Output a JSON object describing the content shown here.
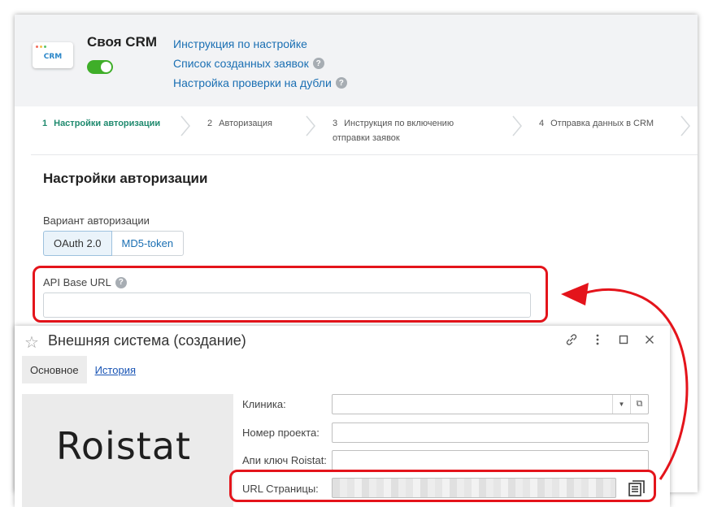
{
  "crm": {
    "logo_text": "CRM",
    "name": "Своя CRM",
    "links": [
      {
        "label": "Инструкция по настройке",
        "help": false
      },
      {
        "label": "Список созданных заявок",
        "help": true
      },
      {
        "label": "Настройка проверки на дубли",
        "help": true
      }
    ],
    "toggle_on": true
  },
  "steps": [
    {
      "num": "1",
      "label": "Настройки авторизации",
      "active": true
    },
    {
      "num": "2",
      "label": "Авторизация",
      "active": false
    },
    {
      "num": "3",
      "label": "Инструкция по включению",
      "label2": "отправки заявок",
      "active": false
    },
    {
      "num": "4",
      "label": "Отправка данных в CRM",
      "active": false
    }
  ],
  "auth": {
    "title": "Настройки авторизации",
    "variant_label": "Вариант авторизации",
    "options": [
      "OAuth 2.0",
      "MD5-token"
    ],
    "selected": "OAuth 2.0",
    "api_label": "API Base URL",
    "api_value": ""
  },
  "window": {
    "title": "Внешняя система (создание)",
    "tabs": [
      "Основное",
      "История"
    ],
    "logo": "Roistat",
    "fields": {
      "clinic": "Клиника:",
      "project": "Номер проекта:",
      "key": "Апи ключ Roistat:",
      "url": "URL Страницы:"
    }
  },
  "colors": {
    "annotation": "#e4141b",
    "link": "#1a6fb3",
    "toggle": "#3fae29",
    "step_active": "#1f8a6e"
  }
}
